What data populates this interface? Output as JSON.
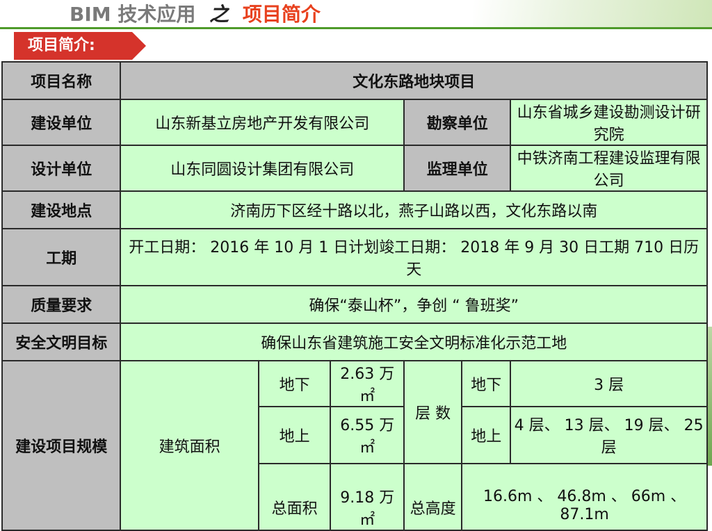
{
  "header": {
    "prefix": "BIM 技术应用",
    "joiner": "之",
    "title": "项目简介"
  },
  "section_tag": "项目简介:",
  "table": {
    "project_name_label": "项目名称",
    "project_name": "文化东路地块项目",
    "builder_label": "建设单位",
    "builder": "山东新基立房地产开发有限公司",
    "survey_label": "勘察单位",
    "survey": "山东省城乡建设勘测设计研究院",
    "designer_label": "设计单位",
    "designer": "山东同圆设计集团有限公司",
    "supervisor_label": "监理单位",
    "supervisor": "中铁济南工程建设监理有限公司",
    "location_label": "建设地点",
    "location": "济南历下区经十路以北，燕子山路以西，文化东路以南",
    "period_label": "工期",
    "period": "开工日期： 2016 年 10 月 1 日计划竣工日期： 2018 年 9 月 30 日工期 710 日历天",
    "quality_label": "质量要求",
    "quality": "确保“泰山杯”，争创 “ 鲁班奖”",
    "safety_label": "安全文明目标",
    "safety": "确保山东省建筑施工安全文明标准化示范工地",
    "scale_label": "建设项目规模",
    "area_label": "建筑面积",
    "underground_label": "地下",
    "underground_area": "2.63 万㎡",
    "aboveground_label": "地上",
    "aboveground_area": "6.55 万㎡",
    "total_area_label": "总面积",
    "total_area": "9.18 万㎡",
    "floors_label": "层 数",
    "floors_under_label": "地下",
    "floors_under": "3 层",
    "floors_above_label": "地上",
    "floors_above": "4 层、 13 层、 19 层、 25 层",
    "total_height_label": "总高度",
    "total_height": "16.6m 、 46.8m 、 66m 、 87.1m"
  }
}
